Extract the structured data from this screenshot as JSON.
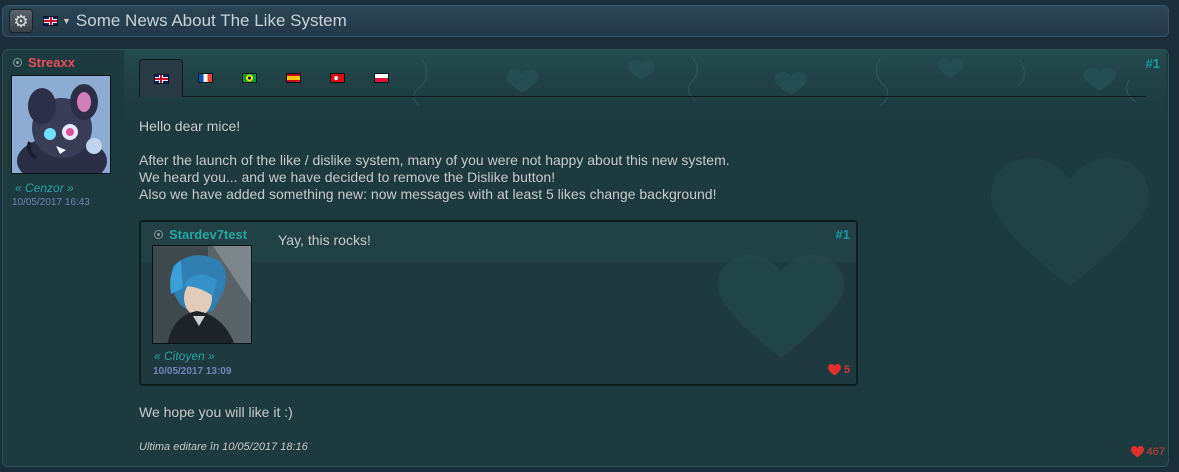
{
  "titlebar": {
    "title": "Some News About The Like System",
    "settings_icon": "gear-icon",
    "language_flag": "uk-flag-icon"
  },
  "post": {
    "author": "Streaxx",
    "author_color": "#e84d5b",
    "role": "« Cenzor »",
    "date": "10/05/2017 16:43",
    "number": "#1",
    "tabs": [
      {
        "flag": "uk-flag-icon",
        "active": true
      },
      {
        "flag": "fr-flag-icon",
        "active": false
      },
      {
        "flag": "br-flag-icon",
        "active": false
      },
      {
        "flag": "es-flag-icon",
        "active": false
      },
      {
        "flag": "tr-flag-icon",
        "active": false
      },
      {
        "flag": "pl-flag-icon",
        "active": false
      }
    ],
    "greeting": "Hello dear mice!",
    "body_lines": [
      "After the launch of the like / dislike system, many of you were not happy about this new system.",
      "We heard you... and we have decided to remove the Dislike button!",
      "Also we have added something new: now messages with at least 5 likes change background!"
    ],
    "closing": "We hope you will like it :)",
    "edited_note": "Ultima editare în 10/05/2017 18:16",
    "likes": "467"
  },
  "quote": {
    "author": "Stardev7test",
    "author_color": "#26a5a0",
    "role": "« Citoyen »",
    "date": "10/05/2017 13:09",
    "number": "#1",
    "text": "Yay, this rocks!",
    "likes": "5"
  },
  "colors": {
    "heart": "#e03030",
    "accent": "#1a9aa0"
  }
}
